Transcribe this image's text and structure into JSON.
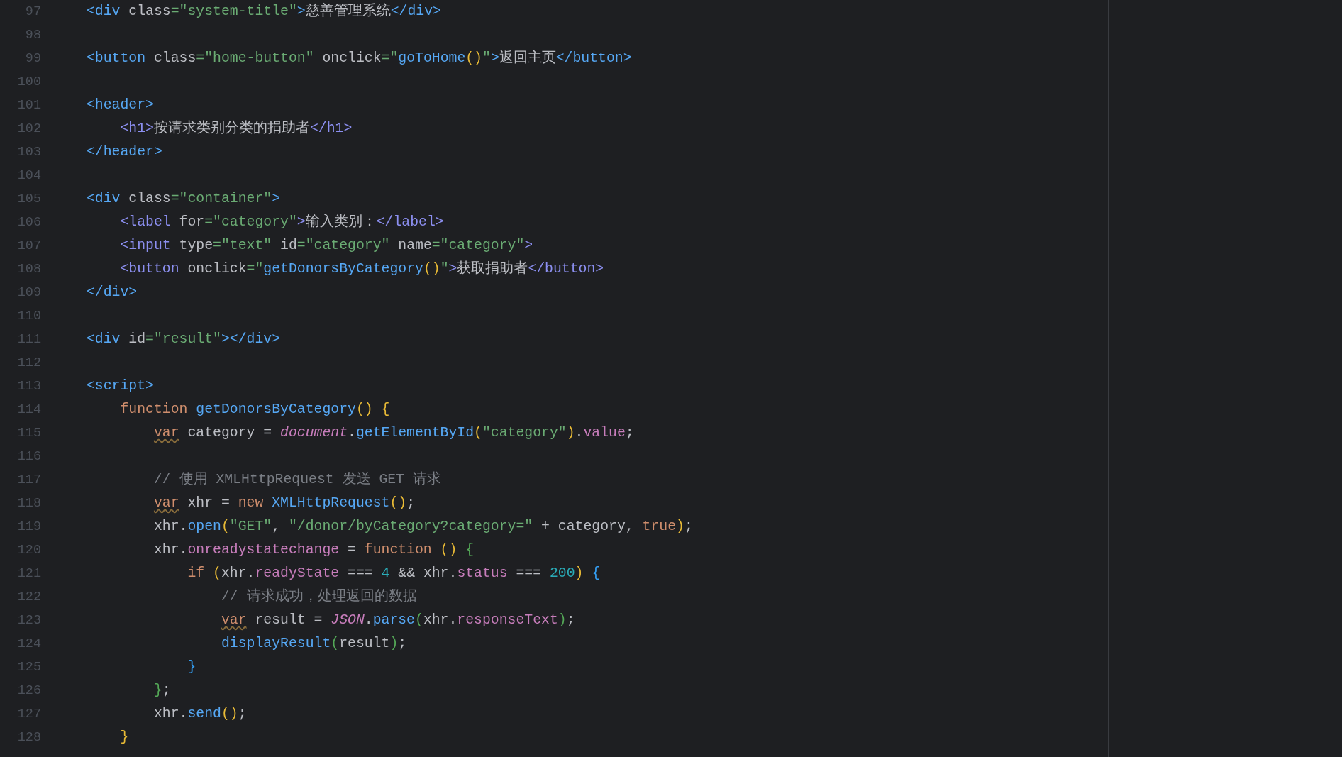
{
  "editor": {
    "lines": [
      {
        "number": "97",
        "tokens": [
          {
            "kind": "tag",
            "text": "<div"
          },
          {
            "kind": "plain",
            "text": " class"
          },
          {
            "kind": "str",
            "text": "=\"system-title\""
          },
          {
            "kind": "tag",
            "text": ">"
          },
          {
            "kind": "plain",
            "text": "慈善管理系统"
          },
          {
            "kind": "tag",
            "text": "</div>"
          }
        ]
      },
      {
        "number": "98"
      },
      {
        "number": "99",
        "tokens": [
          {
            "kind": "tag",
            "text": "<button"
          },
          {
            "kind": "plain",
            "text": " class"
          },
          {
            "kind": "str",
            "text": "=\"home-button\""
          },
          {
            "kind": "plain",
            "text": " onclick"
          },
          {
            "kind": "str",
            "text": "=\""
          },
          {
            "kind": "fn",
            "text": "goToHome"
          },
          {
            "kind": "p1",
            "text": "()"
          },
          {
            "kind": "str",
            "text": "\""
          },
          {
            "kind": "tag",
            "text": ">"
          },
          {
            "kind": "plain",
            "text": "返回主页"
          },
          {
            "kind": "tag",
            "text": "</button>"
          }
        ]
      },
      {
        "number": "100"
      },
      {
        "number": "101",
        "tokens": [
          {
            "kind": "tag",
            "text": "<header>"
          }
        ]
      },
      {
        "number": "102",
        "tokens": [
          {
            "kind": "tag2",
            "text": "    <h1>"
          },
          {
            "kind": "plain",
            "text": "按请求类别分类的捐助者"
          },
          {
            "kind": "tag2",
            "text": "</h1>"
          }
        ]
      },
      {
        "number": "103",
        "tokens": [
          {
            "kind": "tag",
            "text": "</header>"
          }
        ]
      },
      {
        "number": "104"
      },
      {
        "number": "105",
        "tokens": [
          {
            "kind": "tag",
            "text": "<div"
          },
          {
            "kind": "plain",
            "text": " class"
          },
          {
            "kind": "str",
            "text": "=\"container\""
          },
          {
            "kind": "tag",
            "text": ">"
          }
        ]
      },
      {
        "number": "106",
        "tokens": [
          {
            "kind": "tag2",
            "text": "    <label"
          },
          {
            "kind": "plain",
            "text": " for"
          },
          {
            "kind": "str",
            "text": "=\"category\""
          },
          {
            "kind": "tag2",
            "text": ">"
          },
          {
            "kind": "plain",
            "text": "输入类别："
          },
          {
            "kind": "tag2",
            "text": "</label>"
          }
        ]
      },
      {
        "number": "107",
        "tokens": [
          {
            "kind": "tag2",
            "text": "    <input"
          },
          {
            "kind": "plain",
            "text": " type"
          },
          {
            "kind": "str",
            "text": "=\"text\""
          },
          {
            "kind": "plain",
            "text": " id"
          },
          {
            "kind": "str",
            "text": "=\"category\""
          },
          {
            "kind": "plain",
            "text": " name"
          },
          {
            "kind": "str",
            "text": "=\"category\""
          },
          {
            "kind": "tag2",
            "text": ">"
          }
        ]
      },
      {
        "number": "108",
        "tokens": [
          {
            "kind": "tag2",
            "text": "    <button"
          },
          {
            "kind": "plain",
            "text": " onclick"
          },
          {
            "kind": "str",
            "text": "=\""
          },
          {
            "kind": "fn",
            "text": "getDonorsByCategory"
          },
          {
            "kind": "p1",
            "text": "()"
          },
          {
            "kind": "str",
            "text": "\""
          },
          {
            "kind": "tag2",
            "text": ">"
          },
          {
            "kind": "plain",
            "text": "获取捐助者"
          },
          {
            "kind": "tag2",
            "text": "</button>"
          }
        ]
      },
      {
        "number": "109",
        "tokens": [
          {
            "kind": "tag",
            "text": "</div>"
          }
        ]
      },
      {
        "number": "110"
      },
      {
        "number": "111",
        "tokens": [
          {
            "kind": "tag",
            "text": "<div"
          },
          {
            "kind": "plain",
            "text": " id"
          },
          {
            "kind": "str",
            "text": "=\"result\""
          },
          {
            "kind": "tag",
            "text": "></div>"
          }
        ]
      },
      {
        "number": "112"
      },
      {
        "number": "113",
        "tokens": [
          {
            "kind": "tag",
            "text": "<script>"
          }
        ]
      },
      {
        "number": "114",
        "tokens": [
          {
            "kind": "kw",
            "text": "    function "
          },
          {
            "kind": "fn",
            "text": "getDonorsByCategory"
          },
          {
            "kind": "p1",
            "text": "() {"
          }
        ]
      },
      {
        "number": "115",
        "tokens": [
          {
            "kind": "warn",
            "text": "        var"
          },
          {
            "kind": "plain",
            "text": " category = "
          },
          {
            "kind": "glob",
            "text": "document"
          },
          {
            "kind": "plain",
            "text": "."
          },
          {
            "kind": "fn",
            "text": "getElementById"
          },
          {
            "kind": "p1",
            "text": "("
          },
          {
            "kind": "str",
            "text": "\"category\""
          },
          {
            "kind": "p1",
            "text": ")"
          },
          {
            "kind": "plain",
            "text": "."
          },
          {
            "kind": "prop",
            "text": "value"
          },
          {
            "kind": "plain",
            "text": ";"
          }
        ]
      },
      {
        "number": "116"
      },
      {
        "number": "117",
        "tokens": [
          {
            "kind": "cmt",
            "text": "        // 使用 XMLHttpRequest 发送 GET 请求"
          }
        ]
      },
      {
        "number": "118",
        "tokens": [
          {
            "kind": "warn",
            "text": "        var"
          },
          {
            "kind": "plain",
            "text": " xhr = "
          },
          {
            "kind": "kw",
            "text": "new "
          },
          {
            "kind": "fn",
            "text": "XMLHttpRequest"
          },
          {
            "kind": "p1",
            "text": "()"
          },
          {
            "kind": "plain",
            "text": ";"
          }
        ]
      },
      {
        "number": "119",
        "tokens": [
          {
            "kind": "plain",
            "text": "        xhr."
          },
          {
            "kind": "fn",
            "text": "open"
          },
          {
            "kind": "p1",
            "text": "("
          },
          {
            "kind": "str",
            "text": "\"GET\""
          },
          {
            "kind": "plain",
            "text": ", "
          },
          {
            "kind": "str",
            "text": "\""
          },
          {
            "kind": "link",
            "text": "/donor/byCategory?category="
          },
          {
            "kind": "str",
            "text": "\""
          },
          {
            "kind": "plain",
            "text": " + category, "
          },
          {
            "kind": "kw",
            "text": "true"
          },
          {
            "kind": "p1",
            "text": ")"
          },
          {
            "kind": "plain",
            "text": ";"
          }
        ]
      },
      {
        "number": "120",
        "tokens": [
          {
            "kind": "plain",
            "text": "        xhr."
          },
          {
            "kind": "prop",
            "text": "onreadystatechange"
          },
          {
            "kind": "plain",
            "text": " = "
          },
          {
            "kind": "kw",
            "text": "function "
          },
          {
            "kind": "p1",
            "text": "() "
          },
          {
            "kind": "p2",
            "text": "{"
          }
        ]
      },
      {
        "number": "121",
        "tokens": [
          {
            "kind": "kw",
            "text": "            if "
          },
          {
            "kind": "p1",
            "text": "("
          },
          {
            "kind": "plain",
            "text": "xhr."
          },
          {
            "kind": "prop",
            "text": "readyState"
          },
          {
            "kind": "plain",
            "text": " === "
          },
          {
            "kind": "num",
            "text": "4"
          },
          {
            "kind": "plain",
            "text": " && xhr."
          },
          {
            "kind": "prop",
            "text": "status"
          },
          {
            "kind": "plain",
            "text": " === "
          },
          {
            "kind": "num",
            "text": "200"
          },
          {
            "kind": "p1",
            "text": ") "
          },
          {
            "kind": "p3",
            "text": "{"
          }
        ]
      },
      {
        "number": "122",
        "tokens": [
          {
            "kind": "cmt",
            "text": "                // 请求成功，处理返回的数据"
          }
        ]
      },
      {
        "number": "123",
        "tokens": [
          {
            "kind": "warn",
            "text": "                var"
          },
          {
            "kind": "plain",
            "text": " result = "
          },
          {
            "kind": "glob",
            "text": "JSON"
          },
          {
            "kind": "plain",
            "text": "."
          },
          {
            "kind": "fn",
            "text": "parse"
          },
          {
            "kind": "p2",
            "text": "("
          },
          {
            "kind": "plain",
            "text": "xhr."
          },
          {
            "kind": "prop",
            "text": "responseText"
          },
          {
            "kind": "p2",
            "text": ")"
          },
          {
            "kind": "plain",
            "text": ";"
          }
        ]
      },
      {
        "number": "124",
        "tokens": [
          {
            "kind": "fn",
            "text": "                displayResult"
          },
          {
            "kind": "p2",
            "text": "("
          },
          {
            "kind": "plain",
            "text": "result"
          },
          {
            "kind": "p2",
            "text": ")"
          },
          {
            "kind": "plain",
            "text": ";"
          }
        ]
      },
      {
        "number": "125",
        "tokens": [
          {
            "kind": "p3",
            "text": "            }"
          }
        ]
      },
      {
        "number": "126",
        "tokens": [
          {
            "kind": "p2",
            "text": "        }"
          },
          {
            "kind": "plain",
            "text": ";"
          }
        ]
      },
      {
        "number": "127",
        "tokens": [
          {
            "kind": "plain",
            "text": "        xhr."
          },
          {
            "kind": "fn",
            "text": "send"
          },
          {
            "kind": "p1",
            "text": "()"
          },
          {
            "kind": "plain",
            "text": ";"
          }
        ]
      },
      {
        "number": "128",
        "tokens": [
          {
            "kind": "p1",
            "text": "    }"
          }
        ]
      }
    ]
  }
}
